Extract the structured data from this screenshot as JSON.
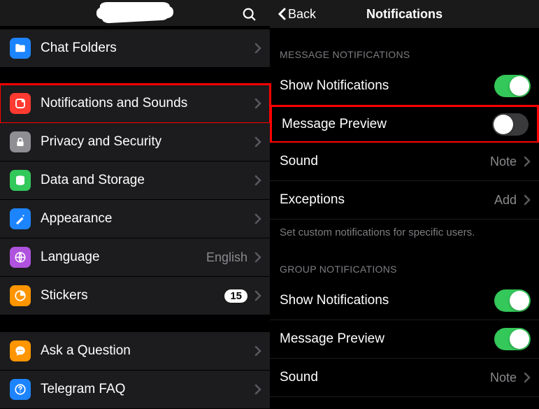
{
  "leftHeader": {
    "blurredName": ""
  },
  "settings": {
    "chatFolders": "Chat Folders",
    "notificationsSounds": "Notifications and Sounds",
    "privacy": "Privacy and Security",
    "dataStorage": "Data and Storage",
    "appearance": "Appearance",
    "language": "Language",
    "languageValue": "English",
    "stickers": "Stickers",
    "stickersBadge": "15",
    "askQuestion": "Ask a Question",
    "faq": "Telegram FAQ"
  },
  "right": {
    "back": "Back",
    "title": "Notifications",
    "msgSection": "MESSAGE NOTIFICATIONS",
    "showNotifications": "Show Notifications",
    "messagePreview": "Message Preview",
    "sound": "Sound",
    "soundValue": "Note",
    "exceptions": "Exceptions",
    "exceptionsValue": "Add",
    "footer": "Set custom notifications for specific users.",
    "groupSection": "GROUP NOTIFICATIONS",
    "gShowNotifications": "Show Notifications",
    "gMessagePreview": "Message Preview",
    "gSound": "Sound",
    "gSoundValue": "Note"
  }
}
